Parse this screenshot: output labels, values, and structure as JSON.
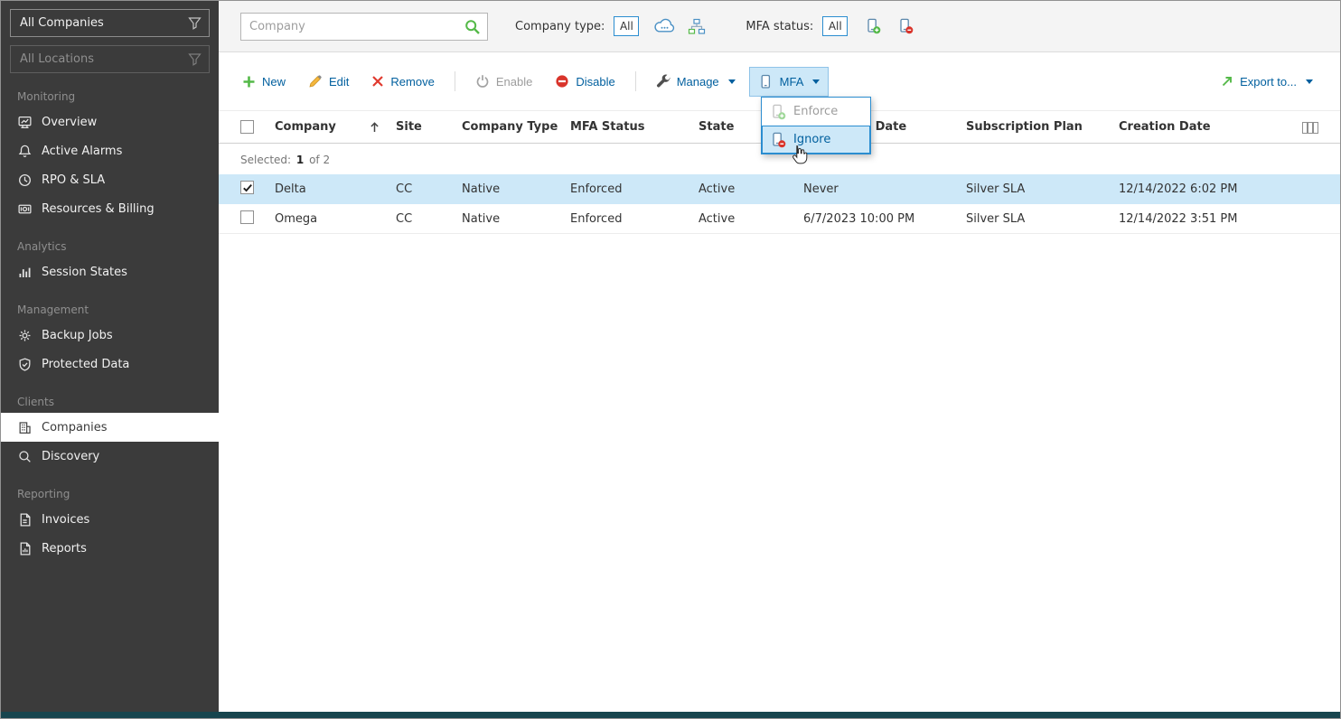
{
  "sidebar": {
    "company_filter": "All Companies",
    "location_filter": "All Locations",
    "sections": [
      {
        "label": "Monitoring",
        "items": [
          {
            "label": "Overview"
          },
          {
            "label": "Active Alarms"
          },
          {
            "label": "RPO & SLA"
          },
          {
            "label": "Resources & Billing"
          }
        ]
      },
      {
        "label": "Analytics",
        "items": [
          {
            "label": "Session States"
          }
        ]
      },
      {
        "label": "Management",
        "items": [
          {
            "label": "Backup Jobs"
          },
          {
            "label": "Protected Data"
          }
        ]
      },
      {
        "label": "Clients",
        "items": [
          {
            "label": "Companies"
          },
          {
            "label": "Discovery"
          }
        ]
      },
      {
        "label": "Reporting",
        "items": [
          {
            "label": "Invoices"
          },
          {
            "label": "Reports"
          }
        ]
      }
    ]
  },
  "filterbar": {
    "search_placeholder": "Company",
    "company_type_label": "Company type:",
    "company_type_all": "All",
    "mfa_status_label": "MFA status:",
    "mfa_status_all": "All"
  },
  "toolbar": {
    "new_label": "New",
    "edit_label": "Edit",
    "remove_label": "Remove",
    "enable_label": "Enable",
    "disable_label": "Disable",
    "manage_label": "Manage",
    "mfa_label": "MFA",
    "export_label": "Export to..."
  },
  "mfa_menu": {
    "enforce": "Enforce",
    "ignore": "Ignore"
  },
  "table": {
    "selected_label": "Selected:",
    "selected_count": "1",
    "selected_total": "of 2",
    "columns": {
      "company": "Company",
      "site": "Site",
      "company_type": "Company Type",
      "mfa_status": "MFA Status",
      "state": "State",
      "expiration_date": "Expiration Date",
      "subscription_plan": "Subscription Plan",
      "creation_date": "Creation Date"
    },
    "rows": [
      {
        "company": "Delta",
        "site": "CC",
        "company_type": "Native",
        "mfa_status": "Enforced",
        "state": "Active",
        "expiration_date": "Never",
        "subscription_plan": "Silver SLA",
        "creation_date": "12/14/2022 6:02 PM"
      },
      {
        "company": "Omega",
        "site": "CC",
        "company_type": "Native",
        "mfa_status": "Enforced",
        "state": "Active",
        "expiration_date": "6/7/2023 10:00 PM",
        "subscription_plan": "Silver SLA",
        "creation_date": "12/14/2022 3:51 PM"
      }
    ]
  },
  "icons": {
    "search": "green magnifier",
    "filter": "funnel",
    "new": "green plus",
    "edit": "yellow pencil",
    "remove": "red x",
    "enable": "gray power",
    "disable": "red no-entry",
    "manage": "wrench",
    "mfa": "phone",
    "mfa_enforce": "phone with green plus",
    "mfa_ignore": "phone with red minus",
    "export": "green diagonal arrow",
    "company_type_cloud": "cloud",
    "company_type_resellers": "hierarchy",
    "sort": "ascending arrow",
    "column_chooser": "vertical bars",
    "cursor": "hand pointer"
  },
  "colors": {
    "accent_blue": "#005f9e",
    "selection_blue": "#cde8f8",
    "green": "#54b948",
    "red": "#d9342b",
    "sidebar_bg": "#3b3b3b",
    "bottom_bar": "#17454e"
  }
}
